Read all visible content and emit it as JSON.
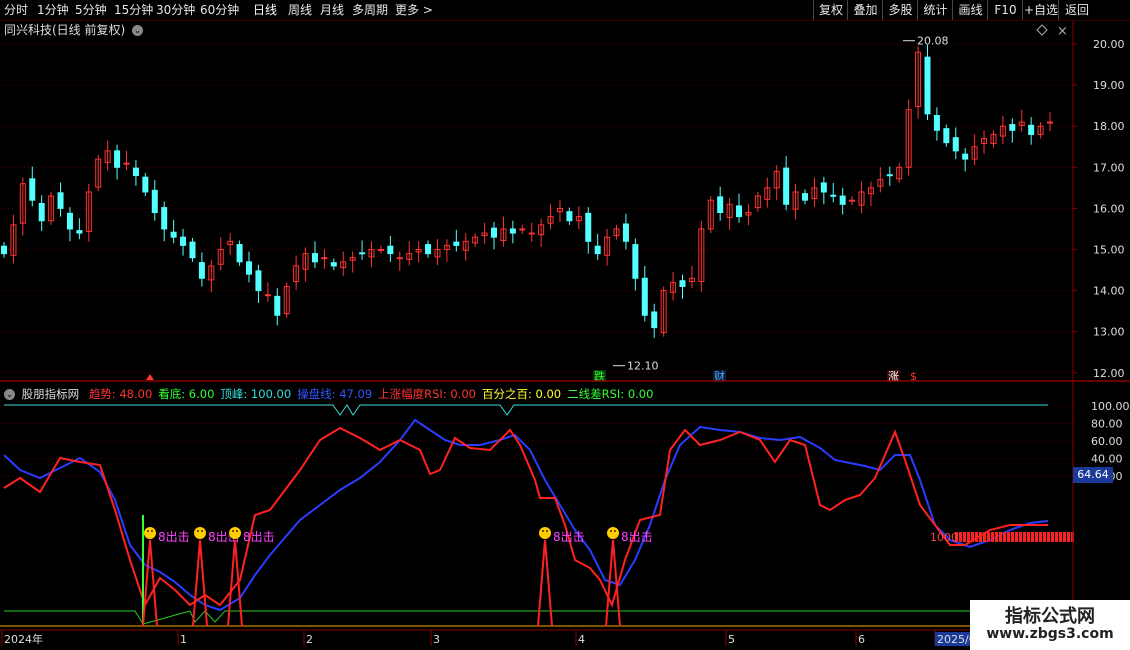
{
  "toolbar": {
    "periods": [
      "分时",
      "1分钟",
      "5分钟",
      "15分钟",
      "30分钟",
      "60分钟",
      "日线",
      "周线",
      "月线",
      "多周期",
      "更多 >"
    ],
    "active_period": "日线",
    "right_buttons": [
      "复权",
      "叠加",
      "多股",
      "统计",
      "画线",
      "F10",
      "+自选",
      "返回"
    ]
  },
  "stock": {
    "title": "同兴科技(日线 前复权)"
  },
  "main_axis": {
    "ticks": [
      "20.00",
      "19.00",
      "18.00",
      "17.00",
      "16.00",
      "15.00",
      "14.00",
      "13.00",
      "12.00"
    ]
  },
  "price_labels": {
    "high": "20.08",
    "low": "12.10"
  },
  "event_markers": {
    "drop": "跌",
    "finance": "财",
    "rise": "涨",
    "s": "$"
  },
  "indicator": {
    "name": "股朋指标网",
    "items": [
      {
        "label": "趋势: 48.00",
        "color": "#ff3333"
      },
      {
        "label": "看底: 6.00",
        "color": "#33ff33"
      },
      {
        "label": "顶峰: 100.00",
        "color": "#33dddd"
      },
      {
        "label": "操盘线: 47.09",
        "color": "#3355ff"
      },
      {
        "label": "上涨幅度RSI: 0.00",
        "color": "#ff3333"
      },
      {
        "label": "百分之百: 0.00",
        "color": "#ffff33"
      },
      {
        "label": "二线差RSI: 0.00",
        "color": "#33ff33"
      }
    ],
    "ticks": [
      "100.00",
      "80.00",
      "60.00",
      "40.00",
      "20.00"
    ],
    "current_value": "64.64",
    "signal_text": "8出击",
    "signal_text_long": "8出击",
    "right_label": "1000"
  },
  "date_axis": [
    "2024年",
    "1",
    "2",
    "3",
    "4",
    "5",
    "6",
    "2025/0"
  ],
  "watermark": {
    "title": "指标公式网",
    "url": "www.zbgs3.com"
  },
  "colors": {
    "up": "#ff3333",
    "down": "#54ffff",
    "trend": "#ff2222",
    "operate": "#2a3cff",
    "peak": "#33dddd",
    "base": "#22cc22",
    "axis": "#8a0000"
  }
}
